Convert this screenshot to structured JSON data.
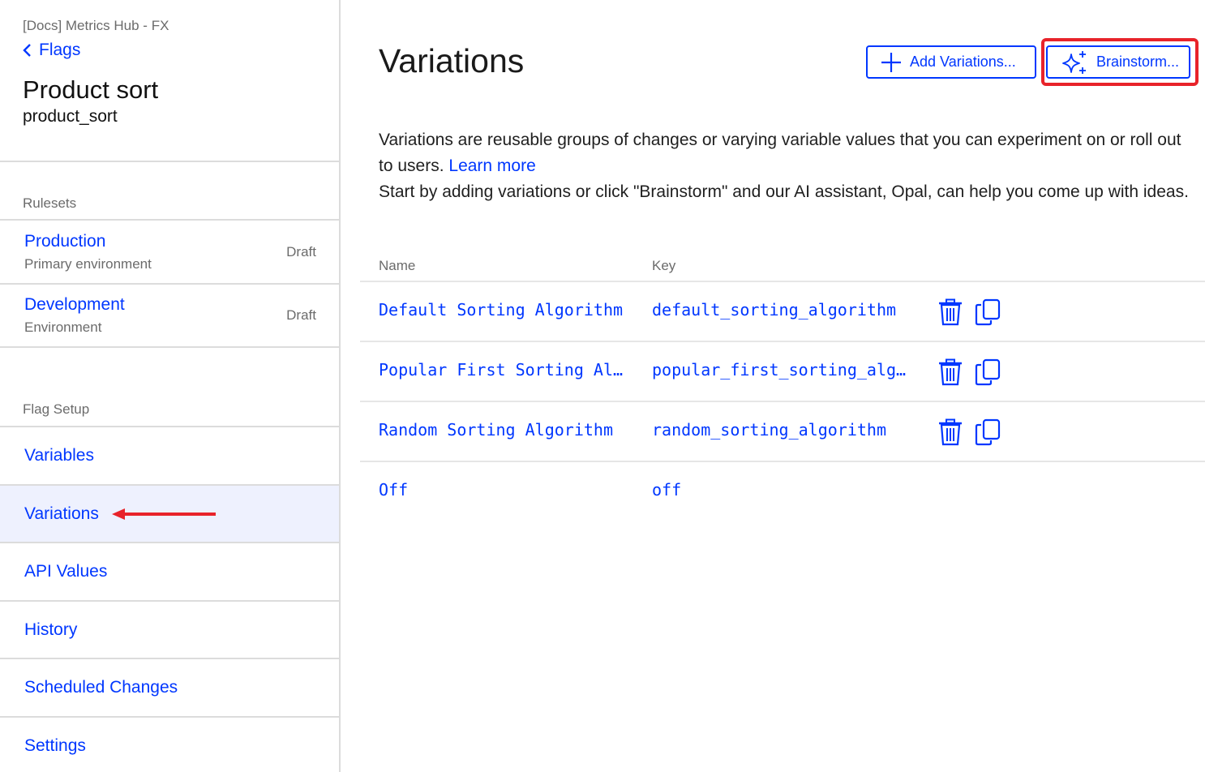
{
  "sidebar": {
    "project_name": "[Docs] Metrics Hub - FX",
    "back_label": "Flags",
    "flag_title": "Product sort",
    "flag_key": "product_sort",
    "rulesets_label": "Rulesets",
    "rulesets": [
      {
        "name": "Production",
        "subtitle": "Primary environment",
        "status": "Draft"
      },
      {
        "name": "Development",
        "subtitle": "Environment",
        "status": "Draft"
      }
    ],
    "flag_setup_label": "Flag Setup",
    "nav": [
      {
        "label": "Variables",
        "active": false
      },
      {
        "label": "Variations",
        "active": true
      },
      {
        "label": "API Values",
        "active": false
      },
      {
        "label": "History",
        "active": false
      },
      {
        "label": "Scheduled Changes",
        "active": false
      },
      {
        "label": "Settings",
        "active": false
      }
    ]
  },
  "main": {
    "title": "Variations",
    "add_button_label": "Add Variations...",
    "brainstorm_button_label": "Brainstorm...",
    "description_line1": "Variations are reusable groups of changes or varying variable values that you can experiment on or roll out to users.",
    "learn_more": "Learn more",
    "description_line2": "Start by adding variations or click \"Brainstorm\" and our AI assistant, Opal, can help you come up with ideas.",
    "columns": {
      "name": "Name",
      "key": "Key"
    },
    "variations": [
      {
        "name": "Default Sorting Algorithm",
        "key": "default_sorting_algorithm",
        "actions": true
      },
      {
        "name": "Popular First Sorting Algorithm",
        "key": "popular_first_sorting_algorithm",
        "actions": true
      },
      {
        "name": "Random Sorting Algorithm",
        "key": "random_sorting_algorithm",
        "actions": true
      },
      {
        "name": "Off",
        "key": "off",
        "actions": false
      }
    ]
  },
  "icons": {
    "back": "chevron-left-icon",
    "add": "plus-icon",
    "brainstorm": "sparkle-icon",
    "delete": "trash-icon",
    "copy": "copy-icon"
  },
  "colors": {
    "link": "#0037ff",
    "highlight": "#e8232a",
    "active_bg": "#eef1fe"
  }
}
